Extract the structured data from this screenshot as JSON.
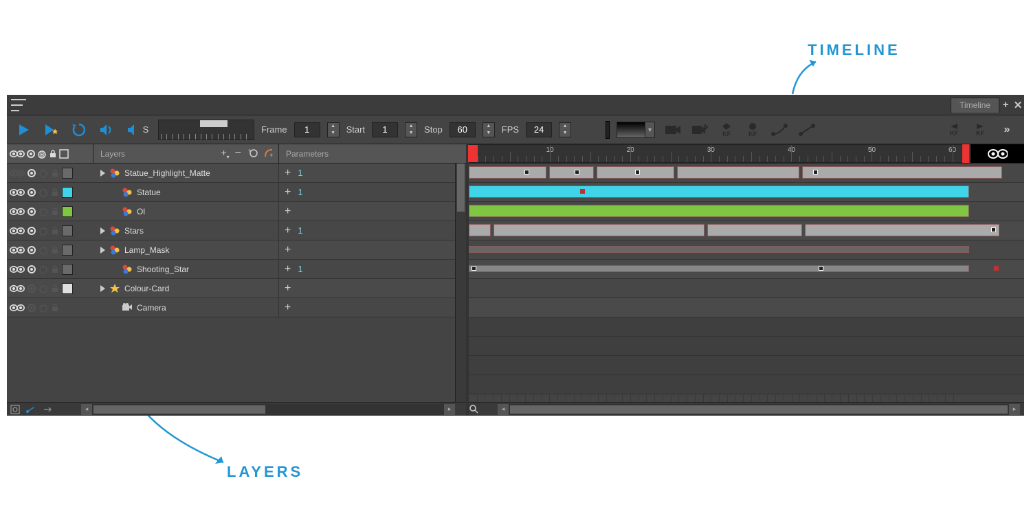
{
  "annotations": {
    "timeline": "TIMELINE",
    "layers": "LAYERS"
  },
  "tab": {
    "title": "Timeline"
  },
  "toolbar": {
    "frame_label": "Frame",
    "frame_value": "1",
    "start_label": "Start",
    "start_value": "1",
    "stop_label": "Stop",
    "stop_value": "60",
    "fps_label": "FPS",
    "fps_value": "24",
    "sound_flag": "S",
    "kf_label": "KF"
  },
  "headers": {
    "layers": "Layers",
    "parameters": "Parameters"
  },
  "ruler": {
    "marks": [
      "10",
      "20",
      "30",
      "40",
      "50",
      "60"
    ]
  },
  "layers": [
    {
      "name": "Statue_Highlight_Matte",
      "param": "1",
      "visible": false,
      "solo": true,
      "expand": true,
      "swatch": "#6a6a6a",
      "indent": 0,
      "icon": "paint"
    },
    {
      "name": "Statue",
      "param": "1",
      "visible": true,
      "solo": true,
      "expand": false,
      "swatch": "#3fd4e8",
      "indent": 1,
      "icon": "paint"
    },
    {
      "name": "Ol",
      "param": "",
      "visible": true,
      "solo": true,
      "expand": false,
      "swatch": "#7fc642",
      "indent": 1,
      "icon": "paint"
    },
    {
      "name": "Stars",
      "param": "1",
      "visible": true,
      "solo": true,
      "expand": true,
      "swatch": "#6a6a6a",
      "indent": 0,
      "icon": "paint"
    },
    {
      "name": "Lamp_Mask",
      "param": "",
      "visible": true,
      "solo": true,
      "expand": true,
      "swatch": "#6a6a6a",
      "indent": 0,
      "icon": "paint"
    },
    {
      "name": "Shooting_Star",
      "param": "1",
      "visible": true,
      "solo": true,
      "expand": false,
      "swatch": "#6a6a6a",
      "indent": 1,
      "icon": "paint"
    },
    {
      "name": "Colour-Card",
      "param": "",
      "visible": true,
      "solo": false,
      "expand": true,
      "swatch": "#e0e0e0",
      "indent": 0,
      "icon": "star"
    },
    {
      "name": "Camera",
      "param": "",
      "visible": true,
      "solo": false,
      "expand": false,
      "swatch": "",
      "indent": 1,
      "icon": "camera"
    }
  ]
}
